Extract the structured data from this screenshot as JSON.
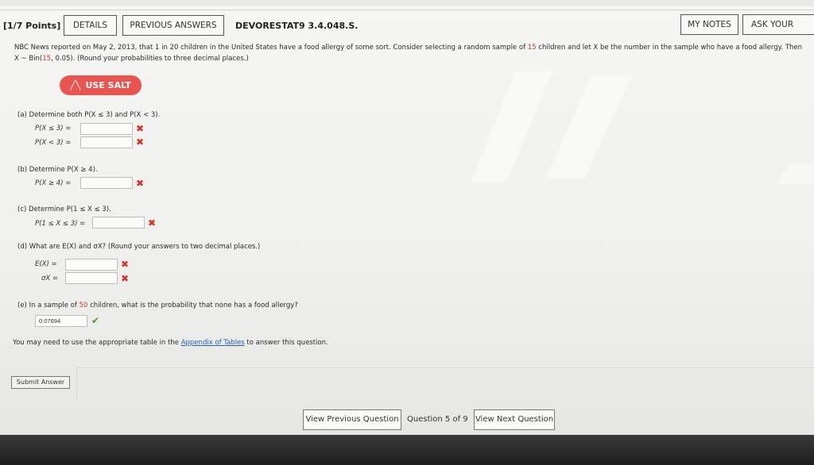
{
  "header": {
    "points": "[1/7 Points]",
    "tabs": {
      "details": "DETAILS",
      "previous_answers": "PREVIOUS ANSWERS"
    },
    "question_id": "DEVORESTAT9 3.4.048.S.",
    "my_notes": "MY NOTES",
    "ask_teacher": "ASK YOUR TEAC"
  },
  "problem": {
    "line1_a": "NBC News reported on May 2, 2013, that 1 in 20 children in the United States have a food allergy of some sort. Consider selecting a random sample of ",
    "line1_n": "15",
    "line1_b": " children and let X be the number in the sample who have a food allergy. Then",
    "line2_a": "X ~ Bin(",
    "line2_n": "15",
    "line2_b": ", 0.05). (Round your probabilities to three decimal places.)"
  },
  "salt_button": "USE SALT",
  "parts": {
    "a": {
      "prompt": "(a)  Determine both P(X ≤ 3) and P(X < 3).",
      "label1": "P(X ≤ 3)  =",
      "label2": "P(X < 3)  =",
      "value1": "",
      "value2": ""
    },
    "b": {
      "prompt": "(b)  Determine P(X ≥ 4).",
      "label1": "P(X ≥ 4)  =",
      "value1": ""
    },
    "c": {
      "prompt": "(c)  Determine P(1 ≤ X ≤ 3).",
      "label1": "P(1 ≤ X ≤ 3) =",
      "value1": ""
    },
    "d": {
      "prompt": "(d)  What are E(X) and σX? (Round your answers to two decimal places.)",
      "label1": "E(X)  =",
      "label2": "σX  =",
      "value1": "",
      "value2": ""
    },
    "e": {
      "prompt_a": "(e)  In a sample of ",
      "prompt_n": "50",
      "prompt_b": " children, what is the probability that none has a food allergy?",
      "value1": "0.07694"
    }
  },
  "marks": {
    "wrong": "✖",
    "correct": "✔"
  },
  "note": {
    "before": "You may need to use the appropriate table in the ",
    "link": "Appendix of Tables",
    "after": " to answer this question."
  },
  "submit": "Submit Answer",
  "nav": {
    "previous": "View Previous Question",
    "position": "Question 5 of 9",
    "next": "View Next Question"
  },
  "colors": {
    "salt": "#e8544f",
    "wrong": "#d2342c",
    "correct": "#4a9a2c",
    "link": "#2a5db0"
  }
}
